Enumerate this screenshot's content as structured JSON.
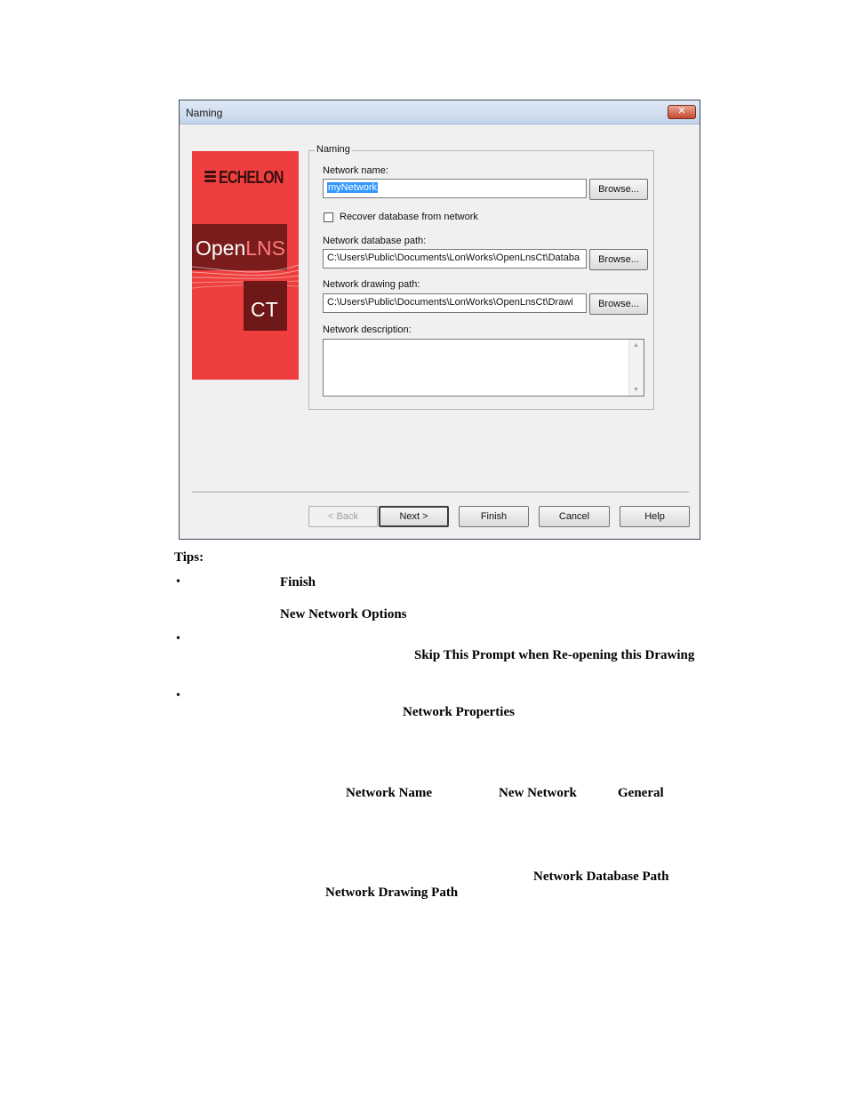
{
  "dialog": {
    "title": "Naming",
    "close_glyph": "✕",
    "logo": {
      "brand": "ECHELON",
      "product_open": "Open",
      "product_lns": "LNS",
      "product_ct": "CT"
    },
    "group_label": "Naming",
    "network_name": {
      "label": "Network name:",
      "value": "myNetwork",
      "browse": "Browse..."
    },
    "recover": {
      "label": "Recover database from network",
      "checked": false
    },
    "database_path": {
      "label": "Network database path:",
      "value": "C:\\Users\\Public\\Documents\\LonWorks\\OpenLnsCt\\Databa",
      "browse": "Browse..."
    },
    "drawing_path": {
      "label": "Network drawing path:",
      "value": "C:\\Users\\Public\\Documents\\LonWorks\\OpenLnsCt\\Drawi",
      "browse": "Browse..."
    },
    "description": {
      "label": "Network description:",
      "value": ""
    },
    "buttons": {
      "back": "< Back",
      "next": "Next >",
      "finish": "Finish",
      "cancel": "Cancel",
      "help": "Help"
    }
  },
  "doc": {
    "tips": "Tips:",
    "bullet": "•",
    "words": {
      "finish": "Finish",
      "new_network_options": "New Network Options",
      "skip_prompt": "Skip This Prompt when Re-opening this Drawing",
      "network_properties": "Network Properties",
      "network_name": "Network Name",
      "new_network": "New Network",
      "general": "General",
      "network_database_path": "Network Database Path",
      "network_drawing_path": "Network Drawing Path"
    }
  },
  "colors": {
    "logo_red": "#ee3e3e",
    "logo_dark": "#7a1c1c",
    "selection": "#3399ff"
  }
}
